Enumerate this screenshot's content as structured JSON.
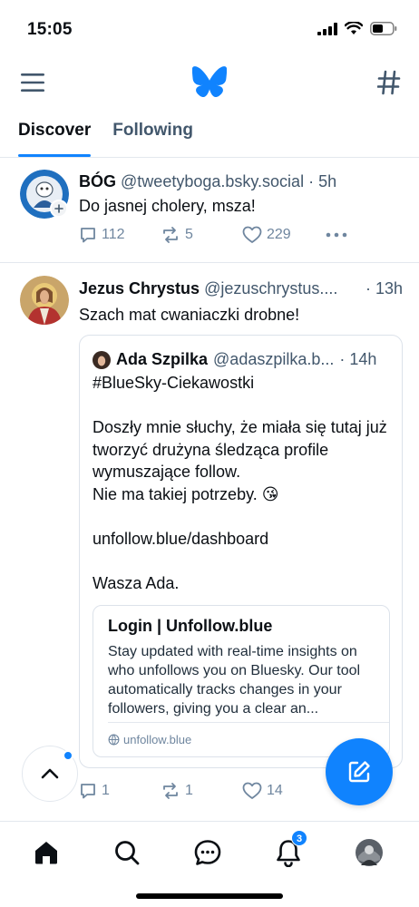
{
  "status": {
    "time": "15:05"
  },
  "tabs": [
    {
      "label": "Discover"
    },
    {
      "label": "Following"
    }
  ],
  "posts": [
    {
      "author": "BÓG",
      "handle": "@tweetyboga.bsky.social",
      "time": "· 5h",
      "text": "Do jasnej cholery, msza!",
      "replies": "112",
      "reposts": "5",
      "likes": "229"
    },
    {
      "author": "Jezus Chrystus",
      "handle": "@jezuschrystus....",
      "time": "· 13h",
      "text": "Szach mat cwaniaczki drobne!",
      "replies": "1",
      "reposts": "1",
      "likes": "14",
      "quote": {
        "author": "Ada Szpilka",
        "handle": "@adaszpilka.b...",
        "time": "· 14h",
        "text": "#BlueSky-Ciekawostki\n\nDoszły mnie słuchy, że miała się tutaj już tworzyć drużyna śledząca profile wymuszające follow.\nNie ma takiej potrzeby. 😘\n\nunfollow.blue/dashboard\n\nWasza Ada.",
        "link": {
          "title": "Login | Unfollow.blue",
          "description": "Stay updated with real-time insights on who unfollows you on Bluesky. Our tool automatically tracks changes in your followers, giving you a clear an...",
          "domain": "unfollow.blue"
        }
      }
    }
  ],
  "nav": {
    "notifications_badge": "3"
  },
  "colors": {
    "accent": "#1083fe",
    "muted": "#6f869f",
    "handle": "#42576c",
    "border": "#e3e8ee"
  }
}
